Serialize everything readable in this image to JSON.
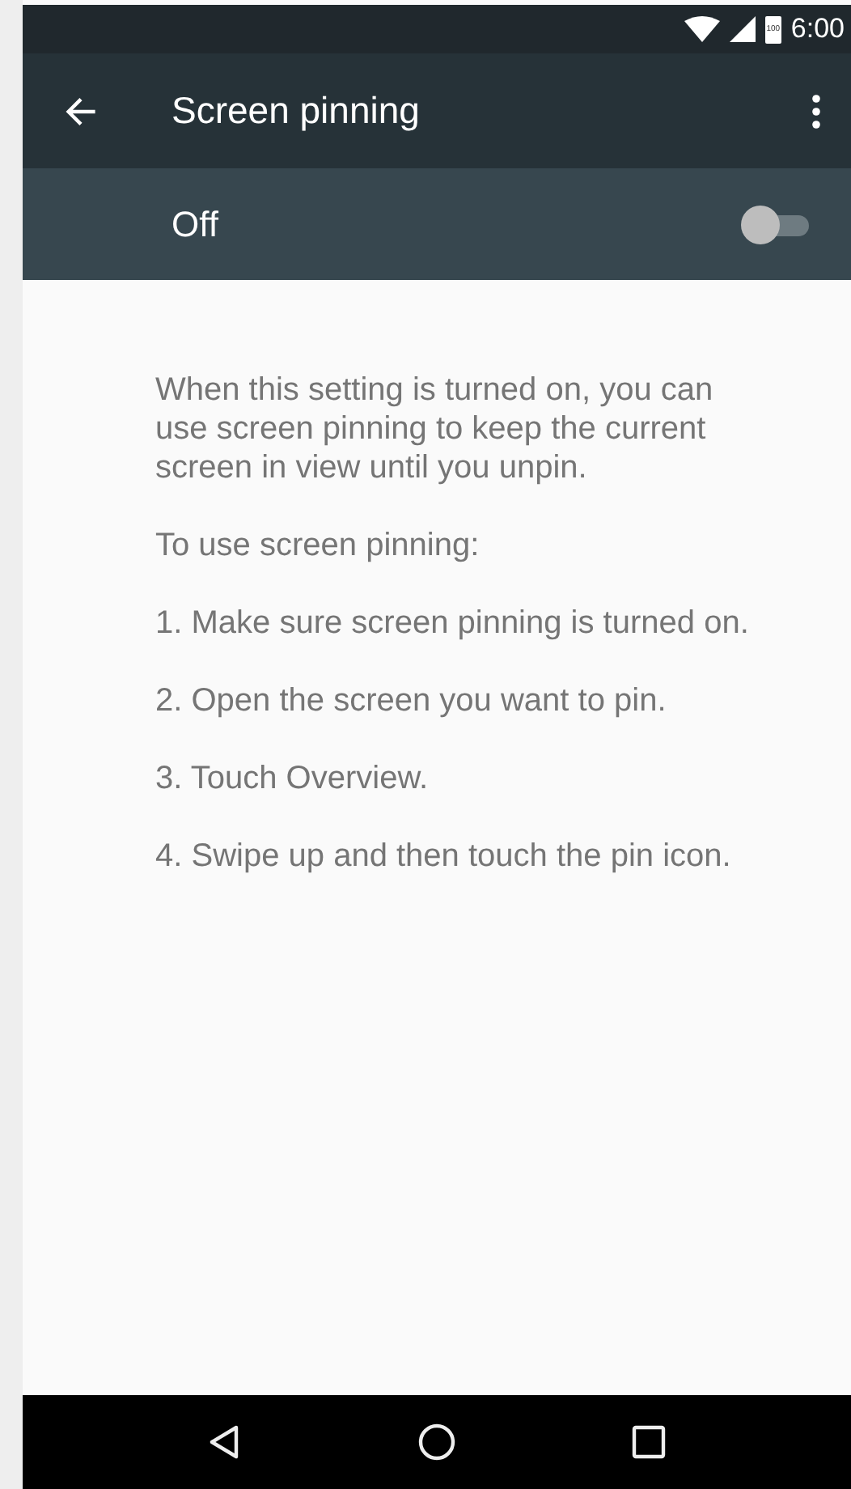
{
  "status_bar": {
    "battery": "100",
    "time": "6:00"
  },
  "toolbar": {
    "title": "Screen pinning"
  },
  "switch_bar": {
    "label": "Off",
    "on": false
  },
  "paragraphs": [
    "When this setting is turned on, you can use screen pinning to keep the current screen in view until you unpin.",
    "To use screen pinning:",
    "1. Make sure screen pinning is turned on.",
    "2. Open the screen you want to pin.",
    "3. Touch Overview.",
    "4. Swipe up and then touch the pin icon."
  ]
}
